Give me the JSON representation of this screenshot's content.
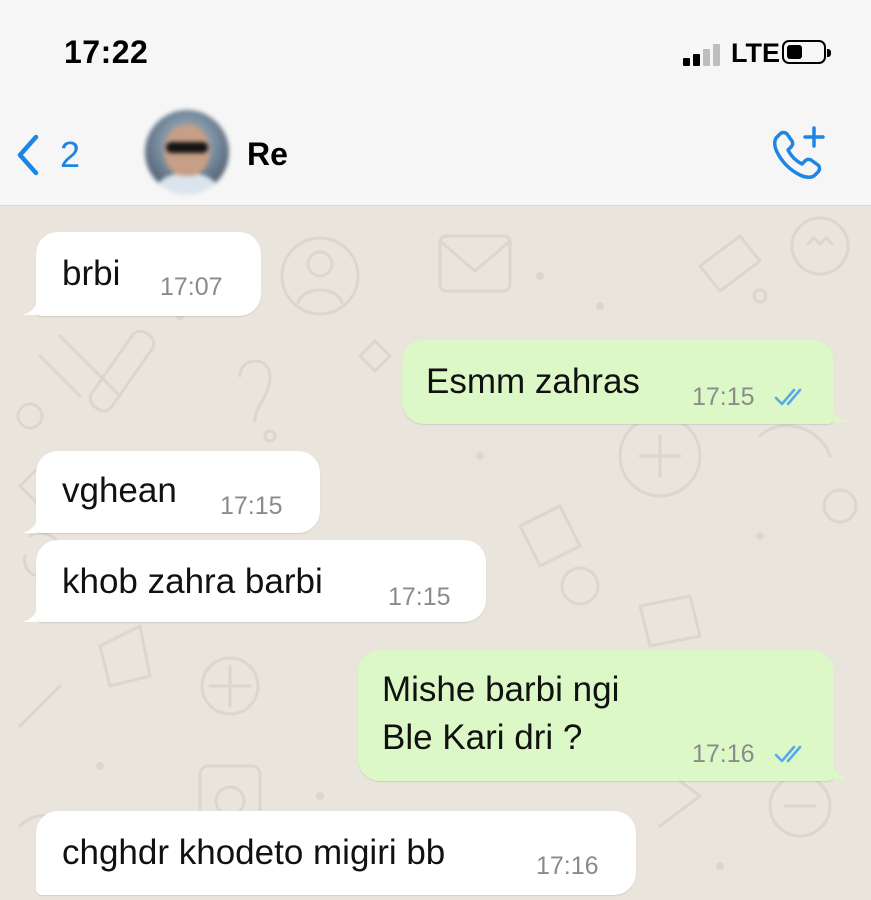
{
  "status_bar": {
    "time": "17:22",
    "network": "LTE"
  },
  "header": {
    "back_count": "2",
    "contact_name": "Re"
  },
  "messages": [
    {
      "direction": "incoming",
      "text": "brbi",
      "time": "17:07"
    },
    {
      "direction": "outgoing",
      "text": "Esmm zahras",
      "time": "17:15",
      "status": "read"
    },
    {
      "direction": "incoming",
      "text": "vghean",
      "time": "17:15"
    },
    {
      "direction": "incoming",
      "text": "khob zahra barbi",
      "time": "17:15"
    },
    {
      "direction": "outgoing",
      "text": "Mishe barbi ngi\nBle Kari dri ?",
      "time": "17:16",
      "status": "read"
    },
    {
      "direction": "incoming",
      "text": "chghdr khodeto migiri bb",
      "time": "17:16"
    }
  ],
  "colors": {
    "accent": "#1d86e4",
    "incoming_bubble": "#ffffff",
    "outgoing_bubble": "#dcf8c7",
    "chat_background": "#e9e4dc",
    "read_ticks": "#5aa7ea"
  },
  "icons": {
    "back": "chevron-left-icon",
    "call": "phone-plus-icon",
    "read_status": "double-check-icon",
    "signal": "cellular-signal-icon",
    "battery": "battery-icon"
  }
}
